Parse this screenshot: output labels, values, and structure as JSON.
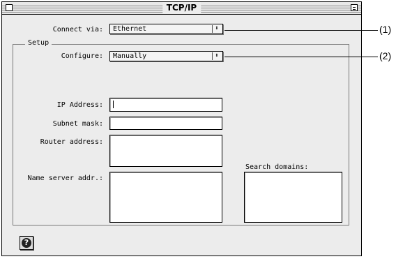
{
  "window": {
    "title": "TCP/IP"
  },
  "connect": {
    "label": "Connect via:",
    "value": "Ethernet"
  },
  "setup": {
    "group_label": "Setup",
    "configure_label": "Configure:",
    "configure_value": "Manually"
  },
  "fields": {
    "ip_label": "IP Address:",
    "ip_value": "",
    "subnet_label": "Subnet mask:",
    "subnet_value": "",
    "router_label": "Router address:",
    "router_value": "",
    "nameserver_label": "Name server addr.:",
    "nameserver_value": "",
    "search_label": "Search domains:",
    "search_value": ""
  },
  "callouts": [
    "(1)",
    "(2)"
  ],
  "icons": {
    "help": "help-icon",
    "popup_arrows": "popup-arrows-icon"
  }
}
